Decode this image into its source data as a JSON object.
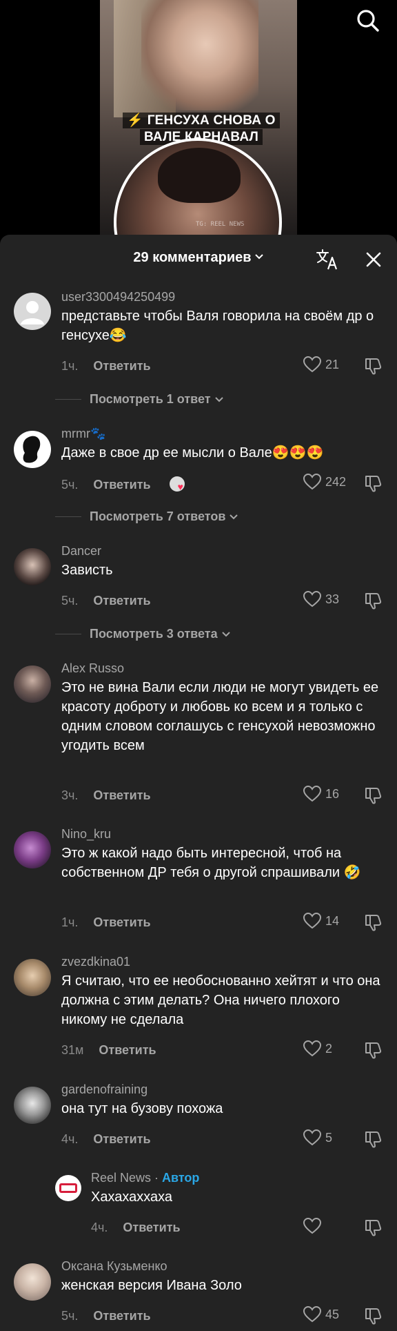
{
  "video": {
    "caption": "⚡ ГЕНСУХА СНОВА О ВАЛЕ КАРНАВАЛ",
    "watermark": "TG: REEL NEWS"
  },
  "sheet": {
    "title": "29 комментариев"
  },
  "comments": [
    {
      "username": "user3300494250499",
      "text": "представьте чтобы Валя говорила на своём др о генсухе😂",
      "time": "1ч.",
      "reply": "Ответить",
      "likes": "21",
      "view_replies": "Посмотреть 1 ответ"
    },
    {
      "username": "mrmr🐾",
      "text": "Даже в свое др ее мысли о Вале😍😍😍",
      "time": "5ч.",
      "reply": "Ответить",
      "likes": "242",
      "view_replies": "Посмотреть 7 ответов"
    },
    {
      "username": "Dancer",
      "text": "Зависть",
      "time": "5ч.",
      "reply": "Ответить",
      "likes": "33",
      "view_replies": "Посмотреть 3 ответа"
    },
    {
      "username": "Alex Russo",
      "text": "Это не вина Вали если люди не могут увидеть ее красоту доброту и любовь ко всем и я только с одним словом соглашусь с генсухой невозможно угодить всем",
      "time": "3ч.",
      "reply": "Ответить",
      "likes": "16"
    },
    {
      "username": "Nino_kru",
      "text": "Это ж какой надо быть интересной, чтоб на собственном ДР тебя о другой спрашивали 🤣",
      "time": "1ч.",
      "reply": "Ответить",
      "likes": "14"
    },
    {
      "username": "zvezdkina01",
      "text": "Я считаю, что ее необоснованно хейтят и что она должна с этим делать? Она ничего плохого никому не сделала",
      "time": "31м",
      "reply": "Ответить",
      "likes": "2"
    },
    {
      "username": "gardenofraining",
      "text": "она тут на бузову похожа",
      "time": "4ч.",
      "reply": "Ответить",
      "likes": "5"
    },
    {
      "username": "Reel News",
      "author_label": "Автор",
      "text": "Хахахаххаха",
      "time": "4ч.",
      "reply": "Ответить",
      "likes": ""
    },
    {
      "username": "Оксана Кузьменко",
      "text": "женская версия Ивана Золо",
      "time": "5ч.",
      "reply": "Ответить",
      "likes": "45"
    }
  ],
  "colors": {
    "sheet_bg": "#232323",
    "author_accent": "#2aa7e6",
    "text_muted": "#a6a6a6"
  },
  "icons": [
    "search-icon",
    "translate-icon",
    "close-icon",
    "heart-icon",
    "dislike-icon",
    "chevron-down-icon"
  ]
}
